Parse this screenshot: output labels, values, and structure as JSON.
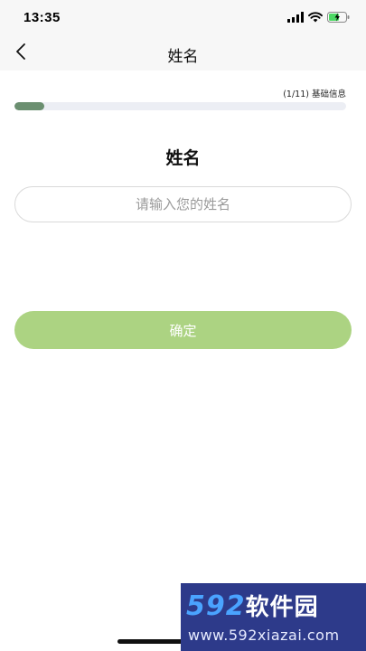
{
  "status_bar": {
    "time": "13:35",
    "icons": [
      "signal-icon",
      "wifi-icon",
      "battery-charging-icon"
    ]
  },
  "nav": {
    "back_icon": "chevron-left-icon",
    "title": "姓名"
  },
  "progress": {
    "label": "(1/11) 基础信息",
    "current": 1,
    "total": 11,
    "fill_color": "#6b8f70",
    "track_color": "#eceef4"
  },
  "form": {
    "heading": "姓名",
    "name_input": {
      "value": "",
      "placeholder": "请输入您的姓名"
    },
    "confirm_label": "确定",
    "confirm_color": "#acd382"
  },
  "watermark": {
    "logo_number": "592",
    "logo_text": "软件园",
    "url": "www.592xiazai.com"
  }
}
